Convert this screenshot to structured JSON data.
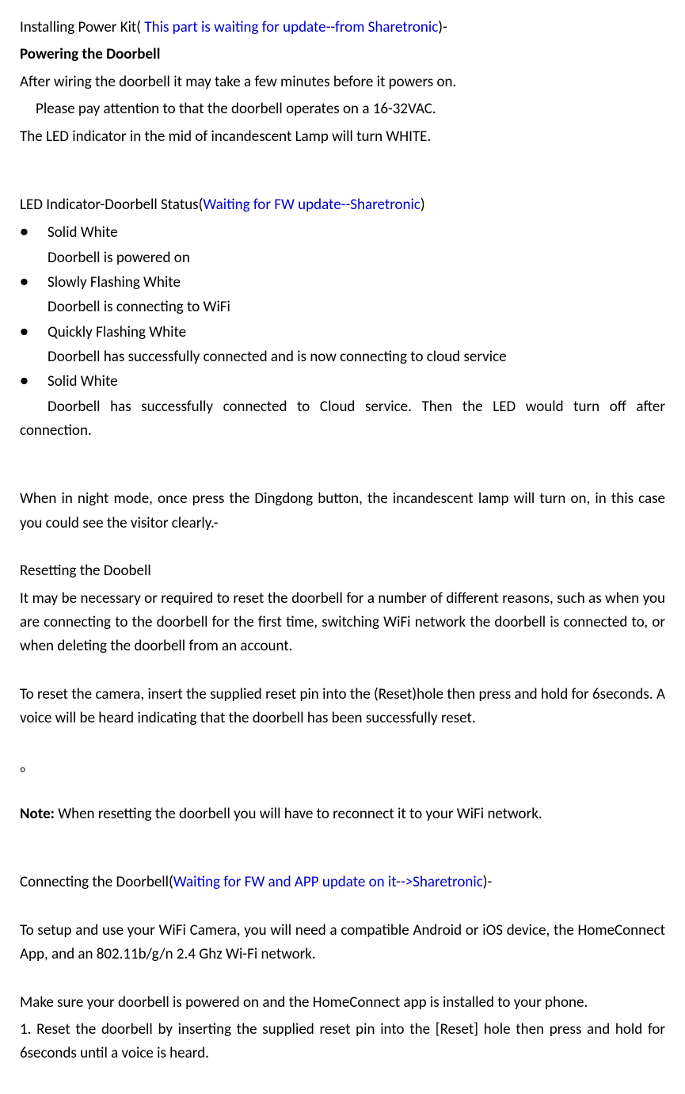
{
  "title": {
    "prefix": "Installing Power Kit( ",
    "blue_note": "This part is waiting for update--from Sharetronic",
    "suffix": ")-"
  },
  "subtitle": "Powering the Doorbell",
  "intro": {
    "line1": "After wiring the doorbell it may take a few minutes before it powers on.",
    "line2": "Please pay attention to that the doorbell operates on a 16-32VAC.",
    "line3": "The LED indicator in the mid of incandescent Lamp will turn WHITE."
  },
  "led_status": {
    "prefix": "LED Indicator-Doorbell Status(",
    "blue_note": "Waiting for FW update--Sharetronic",
    "suffix": ")",
    "items": [
      {
        "title": "Solid White",
        "desc": "Doorbell is powered on"
      },
      {
        "title": "Slowly Flashing White",
        "desc": "Doorbell is connecting to WiFi"
      },
      {
        "title": "Quickly Flashing White",
        "desc": "Doorbell has successfully connected and is now connecting to cloud service"
      },
      {
        "title": "Solid White",
        "desc_line1": "Doorbell has successfully connected to Cloud service. Then the LED would turn off after",
        "desc_line2": "connection."
      }
    ]
  },
  "night_mode": "When in night mode, once press the Dingdong button, the incandescent lamp will turn on, in this case you could see the visitor clearly.-",
  "resetting": {
    "heading": "Resetting the Doobell",
    "p1": "It may be necessary or required to reset the doorbell for a number of different reasons, such as when you are connecting to the doorbell for the first time, switching WiFi network the doorbell is connected to, or when deleting the doorbell from an account.",
    "p2": "To reset the camera, insert the supplied reset pin into the (Reset)hole then press and hold for 6seconds. A voice will be heard indicating that the doorbell has been successfully reset."
  },
  "circle_char": "。",
  "note": {
    "label": "Note:",
    "text": " When resetting the doorbell you will have to reconnect it to your WiFi network."
  },
  "connecting": {
    "prefix": "Connecting the Doorbell(",
    "blue_note": "Waiting for FW and APP update on it-->Sharetronic",
    "suffix": ")-",
    "p1": "To setup and use your WiFi Camera, you will need a compatible Android or iOS device, the HomeConnect App, and an 802.11b/g/n 2.4 Ghz Wi-Fi network.",
    "p2": "Make sure your doorbell is powered on and the HomeConnect app is installed to your phone.",
    "p3": "1. Reset the doorbell by inserting the supplied reset pin into the [Reset] hole then press and hold for 6seconds until a voice is heard."
  }
}
